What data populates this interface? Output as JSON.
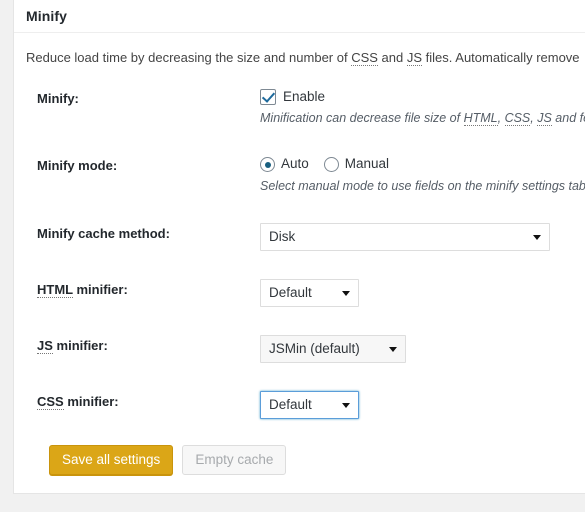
{
  "panel": {
    "title": "Minify",
    "intro": "Reduce load time by decreasing the size and number of CSS and JS files. Automatically remove"
  },
  "intro_abbrs": {
    "css": "CSS",
    "js": "JS"
  },
  "fields": {
    "minify": {
      "label": "Minify:",
      "checkbox_label": "Enable",
      "checked": true,
      "description": "Minification can decrease file size of HTML, CSS, JS and feeds"
    },
    "minify_mode": {
      "label": "Minify mode:",
      "options": [
        "Auto",
        "Manual"
      ],
      "selected": "Auto",
      "description": "Select manual mode to use fields on the minify settings tab t"
    },
    "minify_cache_method": {
      "label": "Minify cache method:",
      "value": "Disk"
    },
    "html_minifier": {
      "label": "HTML minifier:",
      "label_abbr": "HTML",
      "label_rest": " minifier:",
      "value": "Default"
    },
    "js_minifier": {
      "label": "JS minifier:",
      "label_abbr": "JS",
      "label_rest": " minifier:",
      "value": "JSMin (default)"
    },
    "css_minifier": {
      "label": "CSS minifier:",
      "label_abbr": "CSS",
      "label_rest": " minifier:",
      "value": "Default",
      "focused": true
    }
  },
  "buttons": {
    "save": "Save all settings",
    "empty_cache": "Empty cache"
  },
  "colors": {
    "primary_button": "#dba617",
    "focus_ring": "#5b9dd9",
    "radio_dot": "#1a6080",
    "checkmark": "#1e6a9c"
  }
}
